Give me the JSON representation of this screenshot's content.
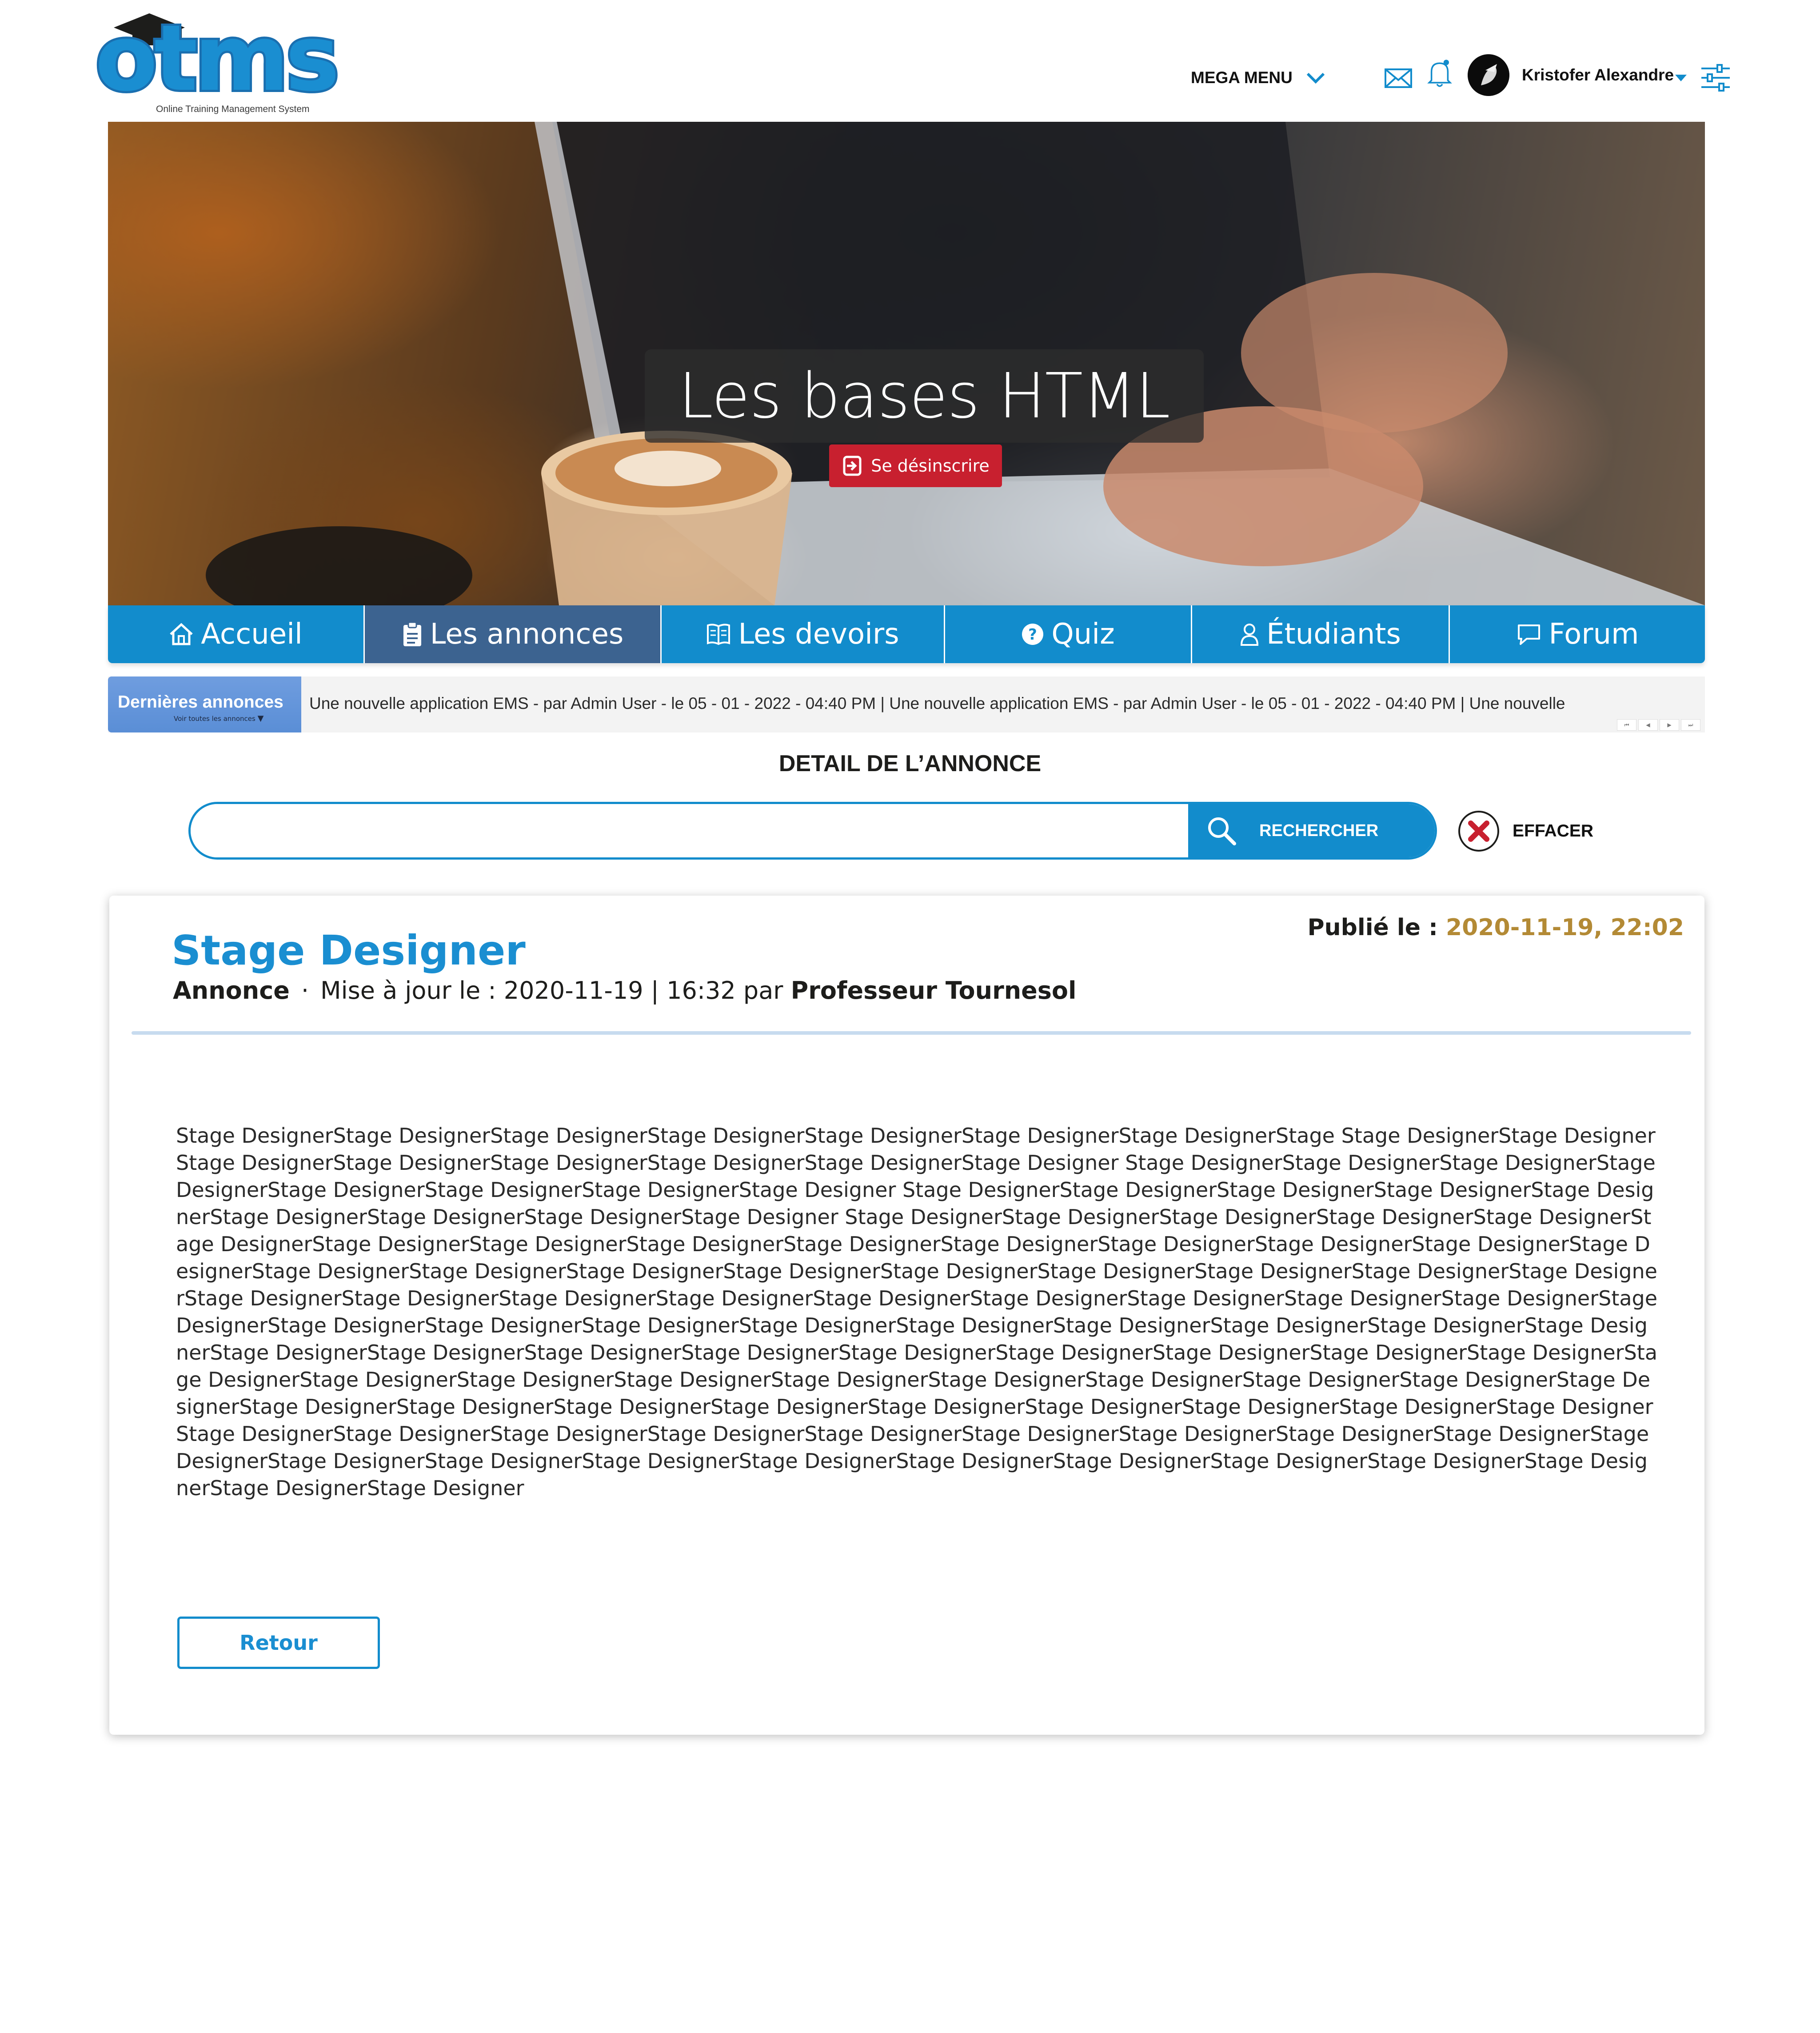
{
  "brand": {
    "logo_text": "otms",
    "tagline": "Online Training Management System"
  },
  "header": {
    "mega_menu_label": "MEGA MENU",
    "user_name": "Kristofer Alexandre",
    "icons": [
      "mail-icon",
      "bell-icon",
      "avatar",
      "caret-down-icon",
      "settings-sliders-icon"
    ]
  },
  "hero": {
    "course_title": "Les bases HTML",
    "unsubscribe_label": "Se désinscrire"
  },
  "nav": {
    "items": [
      {
        "label": "Accueil",
        "icon": "home-icon",
        "active": false
      },
      {
        "label": "Les annonces",
        "icon": "clipboard-icon",
        "active": true
      },
      {
        "label": "Les devoirs",
        "icon": "book-icon",
        "active": false
      },
      {
        "label": "Quiz",
        "icon": "question-icon",
        "active": false
      },
      {
        "label": "Étudiants",
        "icon": "user-icon",
        "active": false
      },
      {
        "label": "Forum",
        "icon": "chat-icon",
        "active": false
      }
    ]
  },
  "ticker": {
    "label": "Dernières annonces",
    "sublabel": "Voir toutes les annonces",
    "text": "Une nouvelle application EMS - par Admin User - le 05 - 01 - 2022 - 04:40 PM | Une nouvelle application EMS - par Admin User - le 05 - 01 - 2022 - 04:40 PM | Une nouvelle",
    "controls": [
      "⏮",
      "◀",
      "▶",
      "⏭"
    ]
  },
  "page": {
    "section_title": "DETAIL DE L’ANNONCE"
  },
  "search": {
    "value": "",
    "placeholder": "",
    "button_label": "RECHERCHER",
    "clear_label": "EFFACER"
  },
  "announcement": {
    "title": "Stage Designer",
    "type": "Annonce",
    "updated_prefix": "Mise à jour le : 2020-11-19 | 16:32 par",
    "author": "Professeur Tournesol",
    "published_label": "Publié le :",
    "published_value": "2020-11-19, 22:02",
    "body": "Stage DesignerStage DesignerStage DesignerStage DesignerStage DesignerStage DesignerStage DesignerStage Stage DesignerStage DesignerStage DesignerStage DesignerStage DesignerStage DesignerStage DesignerStage Designer Stage DesignerStage DesignerStage DesignerStage DesignerStage DesignerStage DesignerStage DesignerStage Designer Stage DesignerStage DesignerStage DesignerStage DesignerStage DesignerStage DesignerStage DesignerStage DesignerStage Designer Stage DesignerStage DesignerStage DesignerStage DesignerStage DesignerStage DesignerStage DesignerStage DesignerStage DesignerStage DesignerStage DesignerStage DesignerStage DesignerStage DesignerStage DesignerStage DesignerStage DesignerStage DesignerStage DesignerStage DesignerStage DesignerStage DesignerStage DesignerStage DesignerStage DesignerStage DesignerStage DesignerStage DesignerStage DesignerStage DesignerStage DesignerStage DesignerStage DesignerStage DesignerStage DesignerStage DesignerStage DesignerStage DesignerStage DesignerStage DesignerStage DesignerStage DesignerStage DesignerStage DesignerStage DesignerStage DesignerStage DesignerStage DesignerStage DesignerStage DesignerStage DesignerStage DesignerStage DesignerStage DesignerStage DesignerStage DesignerStage DesignerStage DesignerStage DesignerStage DesignerStage DesignerStage DesignerStage DesignerStage DesignerStage DesignerStage DesignerStage DesignerStage DesignerStage DesignerStage DesignerStage DesignerStage DesignerStage DesignerStage DesignerStage DesignerStage DesignerStage DesignerStage DesignerStage DesignerStage DesignerStage DesignerStage DesignerStage DesignerStage DesignerStage DesignerStage DesignerStage DesignerStage DesignerStage DesignerStage DesignerStage DesignerStage Designer",
    "back_label": "Retour"
  },
  "colors": {
    "primary": "#128ccc",
    "nav_active": "#3c6390",
    "danger": "#c8202f",
    "published_date": "#b38a35",
    "ticker_label": "#6f9ddf"
  }
}
